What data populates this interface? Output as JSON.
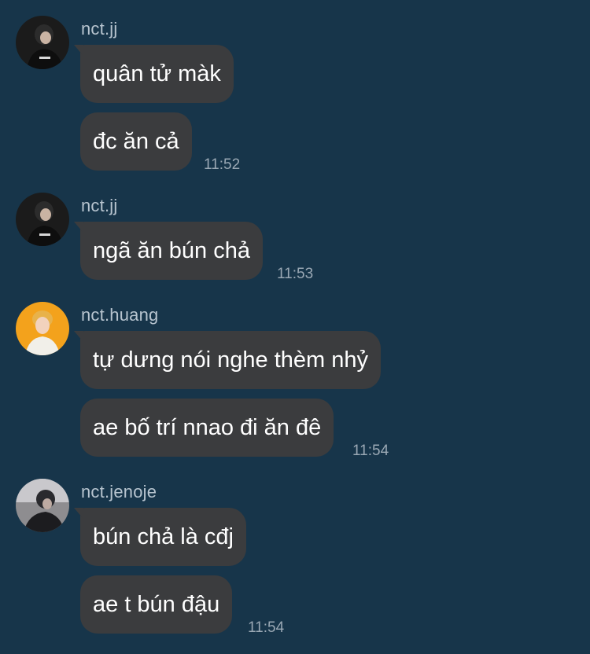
{
  "groups": [
    {
      "sender": "nct.jj",
      "avatar": "avatar-jj",
      "messages": [
        "quân tử màk",
        "đc ăn cả"
      ],
      "time": "11:52"
    },
    {
      "sender": "nct.jj",
      "avatar": "avatar-jj",
      "messages": [
        "ngã ăn bún chả"
      ],
      "time": "11:53"
    },
    {
      "sender": "nct.huang",
      "avatar": "avatar-huang",
      "messages": [
        "tự dưng nói nghe thèm nhỷ",
        "ae bố trí nnao đi ăn đê"
      ],
      "time": "11:54"
    },
    {
      "sender": "nct.jenoje",
      "avatar": "avatar-jenoje",
      "messages": [
        "bún chả là cđj",
        "ae t bún đậu"
      ],
      "time": "11:54"
    }
  ],
  "colors": {
    "background": "#17354a",
    "bubble": "#3b3c3e",
    "sender": "#b7c4cf",
    "time": "#9aa8b4"
  }
}
